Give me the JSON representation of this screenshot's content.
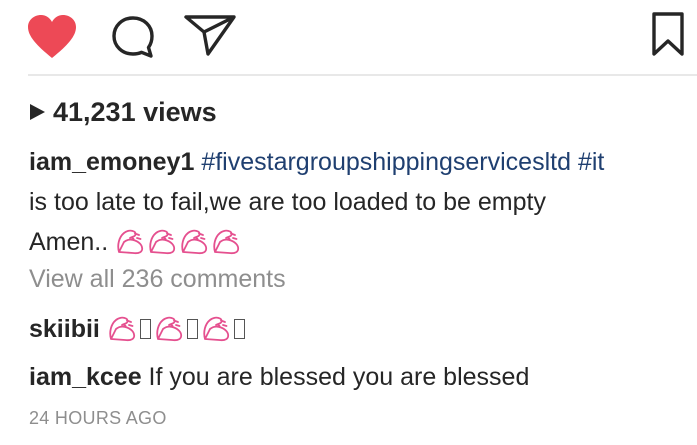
{
  "actions": {
    "like_icon": "heart-filled-icon",
    "comment_icon": "comment-bubble-icon",
    "share_icon": "paper-plane-icon",
    "save_icon": "bookmark-icon",
    "like_color": "#ed4956"
  },
  "post": {
    "views": "41,231 views",
    "caption": {
      "username": "iam_emoney1",
      "hashtag1": "#fivestargroupshippingservicesltd",
      "hashtag2": "#it",
      "line2": "is too late to fail,we are too loaded to be empty",
      "line3": "Amen.. ",
      "emoji": "flexed-biceps"
    },
    "view_all_comments": "View all 236 comments",
    "comments": [
      {
        "username": "skiibii",
        "text": ""
      },
      {
        "username": "iam_kcee",
        "text": " If you are blessed you are blessed"
      }
    ],
    "timestamp": "24 HOURS AGO"
  }
}
